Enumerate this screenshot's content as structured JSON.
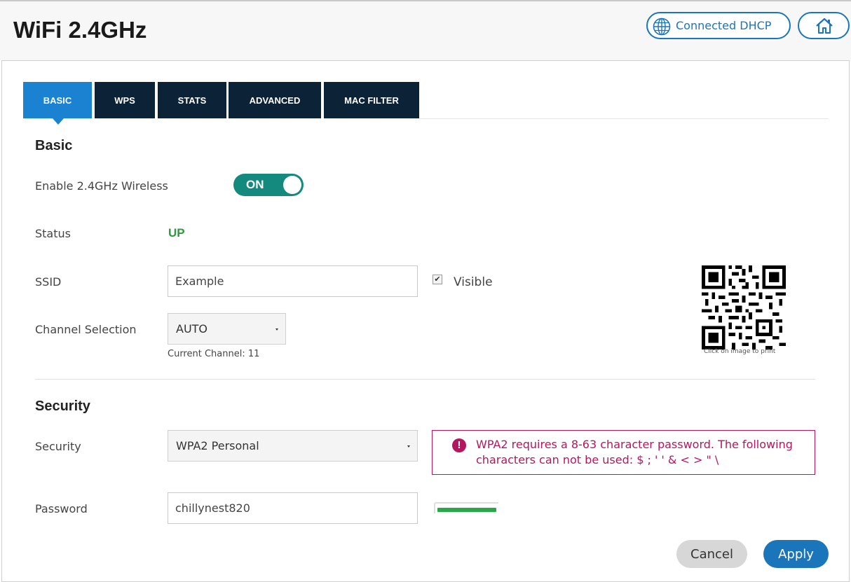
{
  "header": {
    "title": "WiFi 2.4GHz",
    "connection_label": "Connected DHCP",
    "connection_icon": "globe-icon",
    "home_icon": "home-icon",
    "accent_color": "#1b75bb"
  },
  "tabs": [
    {
      "label": "BASIC",
      "active": true
    },
    {
      "label": "WPS",
      "active": false
    },
    {
      "label": "STATS",
      "active": false
    },
    {
      "label": "ADVANCED",
      "active": false
    },
    {
      "label": "MAC FILTER",
      "active": false
    }
  ],
  "basic": {
    "title": "Basic",
    "enable_label": "Enable 2.4GHz Wireless",
    "enable_state": "ON",
    "status_label": "Status",
    "status_value": "UP",
    "ssid_label": "SSID",
    "ssid_value": "Example",
    "visible_label": "Visible",
    "visible_checked": true,
    "channel_label": "Channel Selection",
    "channel_value": "AUTO",
    "current_channel": "Current Channel: 11",
    "qr_caption": "Click on image to print"
  },
  "security": {
    "title": "Security",
    "security_label": "Security",
    "security_value": "WPA2 Personal",
    "warning_text": "WPA2 requires a 8-63 character password. The following characters can not be used: $ ; ' ' & < > \"  \\",
    "warning_icon": "info-icon",
    "warning_color": "#b3175f",
    "password_label": "Password",
    "password_value": "chillynest820",
    "strength_level": 1.0,
    "strength_color": "#2aa64b"
  },
  "actions": {
    "cancel_label": "Cancel",
    "apply_label": "Apply"
  }
}
